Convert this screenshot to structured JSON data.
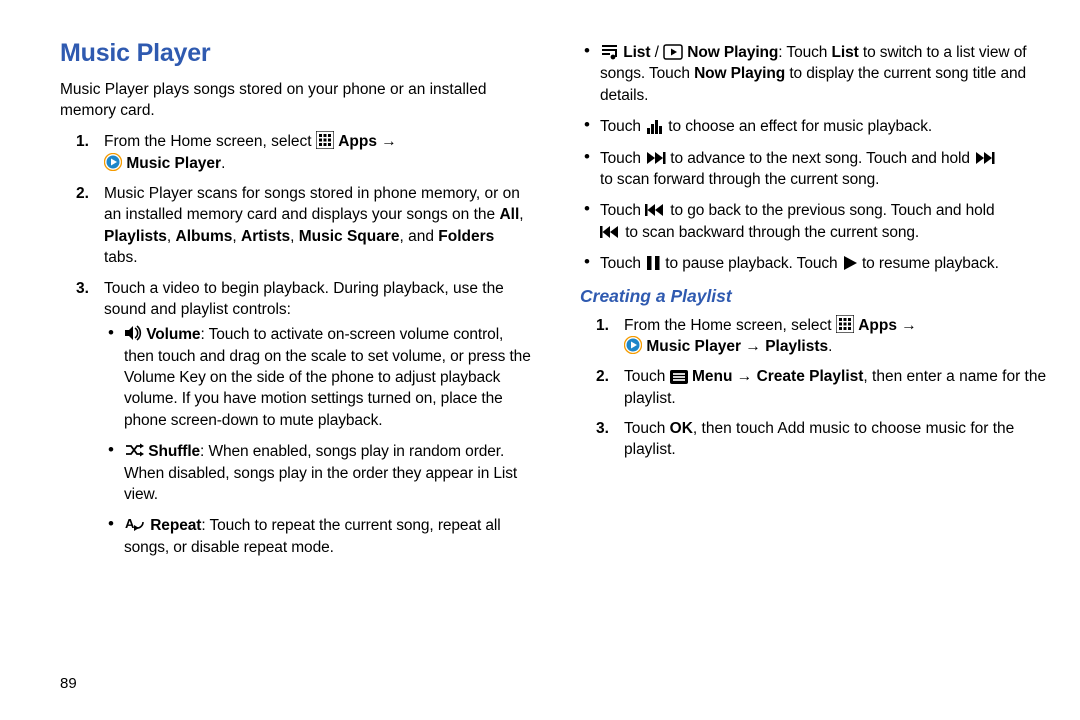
{
  "page_number": "89",
  "title": "Music Player",
  "intro": "Music Player plays songs stored on your phone or an installed memory card.",
  "arrow": "→",
  "steps_main": {
    "s1_a": "From the Home screen, select",
    "s1_apps": "Apps",
    "s1_mp": "Music Player",
    "s2_a": "Music Player scans for songs stored in phone memory, or on an installed memory card and displays your songs on the ",
    "s2_all": "All",
    "s2_pl": "Playlists",
    "s2_al": "Albums",
    "s2_ar": "Artists",
    "s2_ms": "Music Square",
    "s2_and": ", and ",
    "s2_fo": "Folders",
    "s2_tail": " tabs.",
    "s3": "Touch a video to begin playback. During playback, use the sound and playlist controls:"
  },
  "bullets_left": {
    "vol_label": "Volume",
    "vol_text": ": Touch to activate on-screen volume control, then touch and drag on the scale to set volume, or press the Volume Key on the side of the phone to adjust playback volume. If you have motion settings turned on, place the phone screen-down to mute playback.",
    "shu_label": "Shuffle",
    "shu_text": ": When enabled, songs play in random order. When disabled, songs play in the order they appear in List view.",
    "rep_label": "Repeat",
    "rep_text": ": Touch to repeat the current song, repeat all songs, or disable repeat mode."
  },
  "bullets_right": {
    "list_label": "List",
    "slash": " / ",
    "np_label": "Now Playing",
    "list_text_a": ": Touch ",
    "list_text_b": "List",
    "list_text_c": " to switch to a list view of songs. Touch ",
    "list_text_d": "Now Playing",
    "list_text_e": " to display the current song title and details.",
    "touch": "Touch ",
    "eq_text": " to choose an effect for music playback.",
    "next_text_a": " to advance to the next song. Touch and hold ",
    "next_text_b": "to scan forward through the current song.",
    "prev_text_a": " to go back to the previous song. Touch and hold ",
    "prev_text_b": " to scan backward through the current song.",
    "pause_text_a": " to pause playback. Touch ",
    "pause_text_b": " to resume playback."
  },
  "h2": "Creating a Playlist",
  "steps_pl": {
    "s1_a": "From the Home screen, select",
    "s1_apps": "Apps",
    "s1_mp": "Music Player",
    "s1_pl": "Playlists",
    "s2_touch": "Touch ",
    "s2_menu": "Menu",
    "s2_cp": "Create Playlist",
    "s2_tail": ", then enter a name for the playlist.",
    "s3_a": "Touch ",
    "s3_ok": "OK",
    "s3_b": ", then touch Add music to choose music for the playlist."
  }
}
